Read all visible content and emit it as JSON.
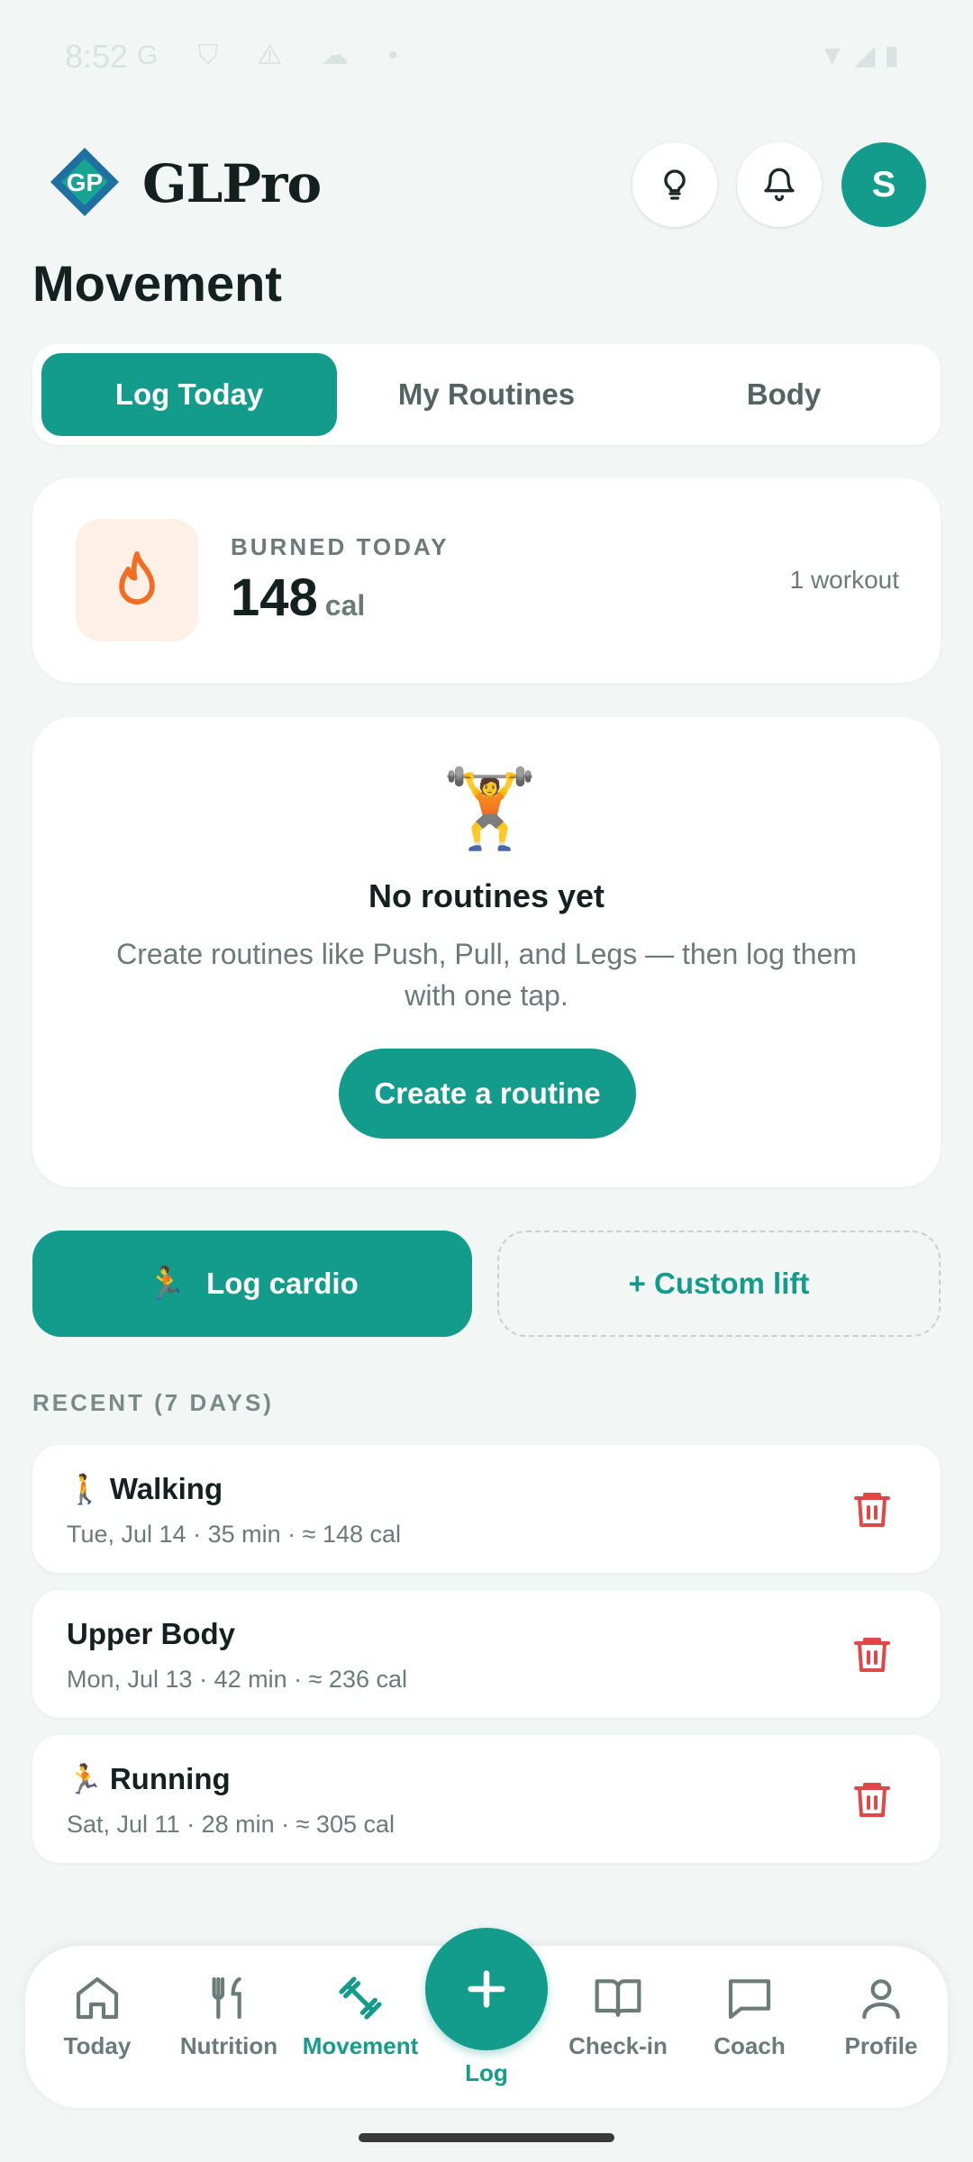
{
  "status_bar": {
    "time": "8:52",
    "left_icons": "G ⛉ ⚠ ☁ •",
    "right_icons": "▼◢▮"
  },
  "header": {
    "app_name": "GLPro",
    "avatar_initial": "S"
  },
  "page": {
    "title": "Movement"
  },
  "tabs": [
    {
      "label": "Log Today",
      "active": true
    },
    {
      "label": "My Routines",
      "active": false
    },
    {
      "label": "Body",
      "active": false
    }
  ],
  "burned": {
    "label": "BURNED TODAY",
    "value": "148",
    "unit": "cal",
    "count": "1 workout"
  },
  "routines_empty": {
    "emoji": "🏋️",
    "title": "No routines yet",
    "description": "Create routines like Push, Pull, and Legs — then log them with one tap.",
    "button": "Create a routine"
  },
  "actions": {
    "cardio_emoji": "🏃",
    "cardio_label": "Log cardio",
    "custom_label": "+ Custom lift"
  },
  "recent": {
    "heading": "RECENT (7 DAYS)",
    "items": [
      {
        "emoji": "🚶",
        "title": "Walking",
        "subtitle": "Tue, Jul 14 · 35 min · ≈ 148 cal"
      },
      {
        "emoji": "",
        "title": "Upper Body",
        "subtitle": "Mon, Jul 13 · 42 min · ≈ 236 cal"
      },
      {
        "emoji": "🏃",
        "title": "Running",
        "subtitle": "Sat, Jul 11 · 28 min · ≈ 305 cal"
      }
    ]
  },
  "nav": {
    "items": [
      {
        "label": "Today",
        "active": false
      },
      {
        "label": "Nutrition",
        "active": false
      },
      {
        "label": "Movement",
        "active": true
      },
      {
        "label": "Check-in",
        "active": false
      },
      {
        "label": "Coach",
        "active": false
      },
      {
        "label": "Profile",
        "active": false
      }
    ],
    "fab_label": "Log"
  },
  "colors": {
    "accent": "#139c8c",
    "background": "#f2f7f6",
    "danger": "#e04848",
    "flame": "#f26d21"
  }
}
